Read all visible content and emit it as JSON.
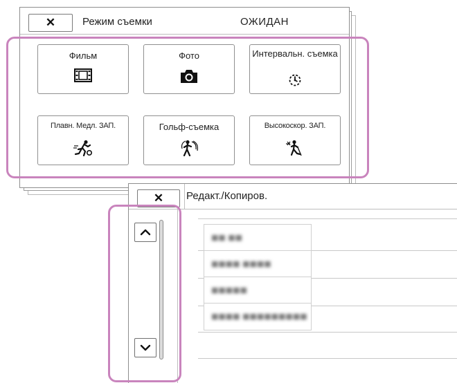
{
  "shooting_mode": {
    "close_label": "✕",
    "title": "Режим съемки",
    "status": "ОЖИДАН",
    "tiles": [
      {
        "label": "Фильм",
        "icon": "film-icon"
      },
      {
        "label": "Фото",
        "icon": "camera-icon"
      },
      {
        "label": "Интервальн. съемка",
        "icon": "interval-timer-icon"
      },
      {
        "label": "Плавн. Медл. ЗАП.",
        "icon": "slow-motion-icon"
      },
      {
        "label": "Гольф-съемка",
        "icon": "golf-swing-icon"
      },
      {
        "label": "Высокоскор. ЗАП.",
        "icon": "high-frame-rate-icon"
      }
    ]
  },
  "edit_copy": {
    "close_label": "✕",
    "title": "Редакт./Копиров.",
    "scroll_up_icon": "chevron-up-icon",
    "scroll_down_icon": "chevron-down-icon",
    "items": [
      {
        "label": "■■ ■■"
      },
      {
        "label": "■■■■ ■■■■"
      },
      {
        "label": "■■■■■"
      },
      {
        "label": "■■■■ ■■■■■■■■■"
      }
    ]
  },
  "colors": {
    "highlight": "#c984bd",
    "border": "#8d8d8d",
    "text": "#222222"
  }
}
